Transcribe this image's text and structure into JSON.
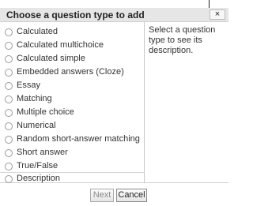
{
  "dialog": {
    "title": "Choose a question type to add",
    "close_label": "×",
    "description": "Select a question type to see its description."
  },
  "options": [
    {
      "label": "Calculated"
    },
    {
      "label": "Calculated multichoice"
    },
    {
      "label": "Calculated simple"
    },
    {
      "label": "Embedded answers (Cloze)"
    },
    {
      "label": "Essay"
    },
    {
      "label": "Matching"
    },
    {
      "label": "Multiple choice"
    },
    {
      "label": "Numerical"
    },
    {
      "label": "Random short-answer matching"
    },
    {
      "label": "Short answer"
    },
    {
      "label": "True/False"
    },
    {
      "label": "Description"
    }
  ],
  "footer": {
    "next_label": "Next",
    "cancel_label": "Cancel"
  },
  "colors": {
    "header_bg": "#e6e6e6",
    "border": "#c9c9c9",
    "text": "#333333"
  }
}
